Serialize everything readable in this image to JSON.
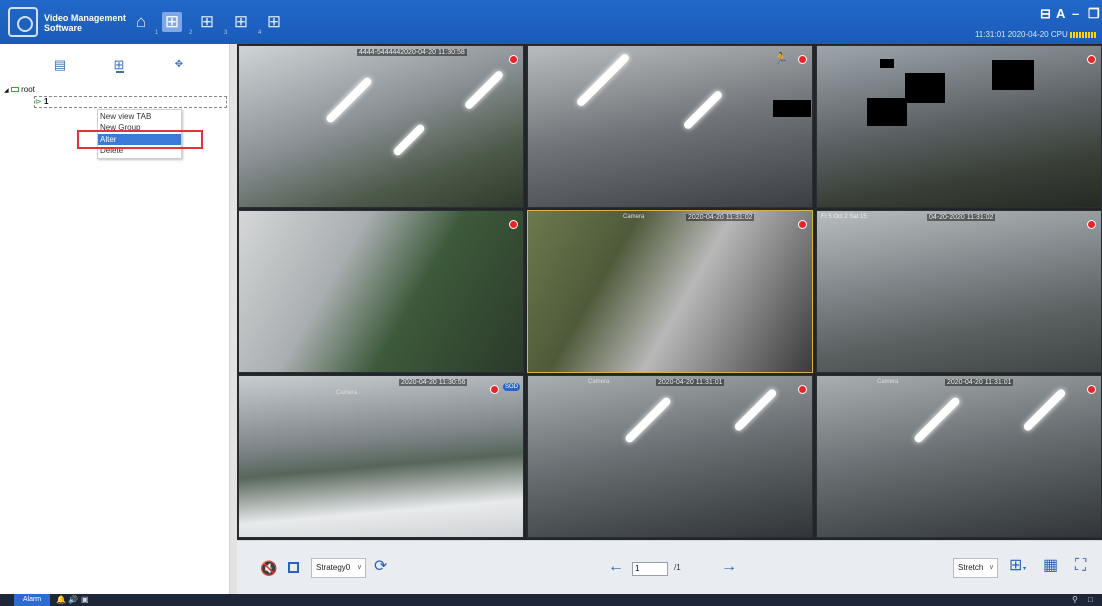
{
  "app": {
    "title_line1": "Video Management",
    "title_line2": "Software",
    "tab_numbers": [
      "1",
      "2",
      "3",
      "4"
    ],
    "window_controls": {
      "screen": "⊟",
      "user": "A",
      "minimize": "–",
      "restore": "❐"
    }
  },
  "status": {
    "time": "11:31:01 2020-04-20",
    "cpu_label": "CPU"
  },
  "colors": {
    "titlebar": "#1f63c4",
    "accent": "#2b63b6",
    "record": "#e8242a",
    "selected_menu": "#3a7bd8"
  },
  "panel": {
    "tab_icons": [
      "device-list-icon",
      "view-grid-icon",
      "ptz-icon"
    ],
    "tree": {
      "root_label": "root",
      "child_label": "1"
    },
    "context_menu": {
      "items": [
        "New view TAB",
        "New Group",
        "Alter",
        "Delete"
      ],
      "selected": "Alter"
    }
  },
  "cameras": [
    {
      "timestamp": "4444-5444442020-04-20 11:30:58",
      "name": ""
    },
    {
      "timestamp": "",
      "name": ""
    },
    {
      "timestamp": "",
      "name": ""
    },
    {
      "timestamp": "",
      "name": ""
    },
    {
      "timestamp": "2020-04-20 11:31:02",
      "name": "Camera"
    },
    {
      "timestamp": "04-20-2020 11:31:02",
      "name": "Fr  5 Oct 2 Sat  15"
    },
    {
      "timestamp": "2020-04-20 11:30:56",
      "name": "Camera",
      "badge": "SOD"
    },
    {
      "timestamp": "2020-04-20 11:31:01",
      "name": "Camera"
    },
    {
      "timestamp": "2020-04-20 11:31:01",
      "name": "Camera"
    }
  ],
  "toolbar": {
    "strategy": "Strategy0",
    "page_current": "1",
    "page_total": "/1",
    "stretch": "Stretch"
  },
  "taskbar": {
    "alarm": "Alarm"
  }
}
